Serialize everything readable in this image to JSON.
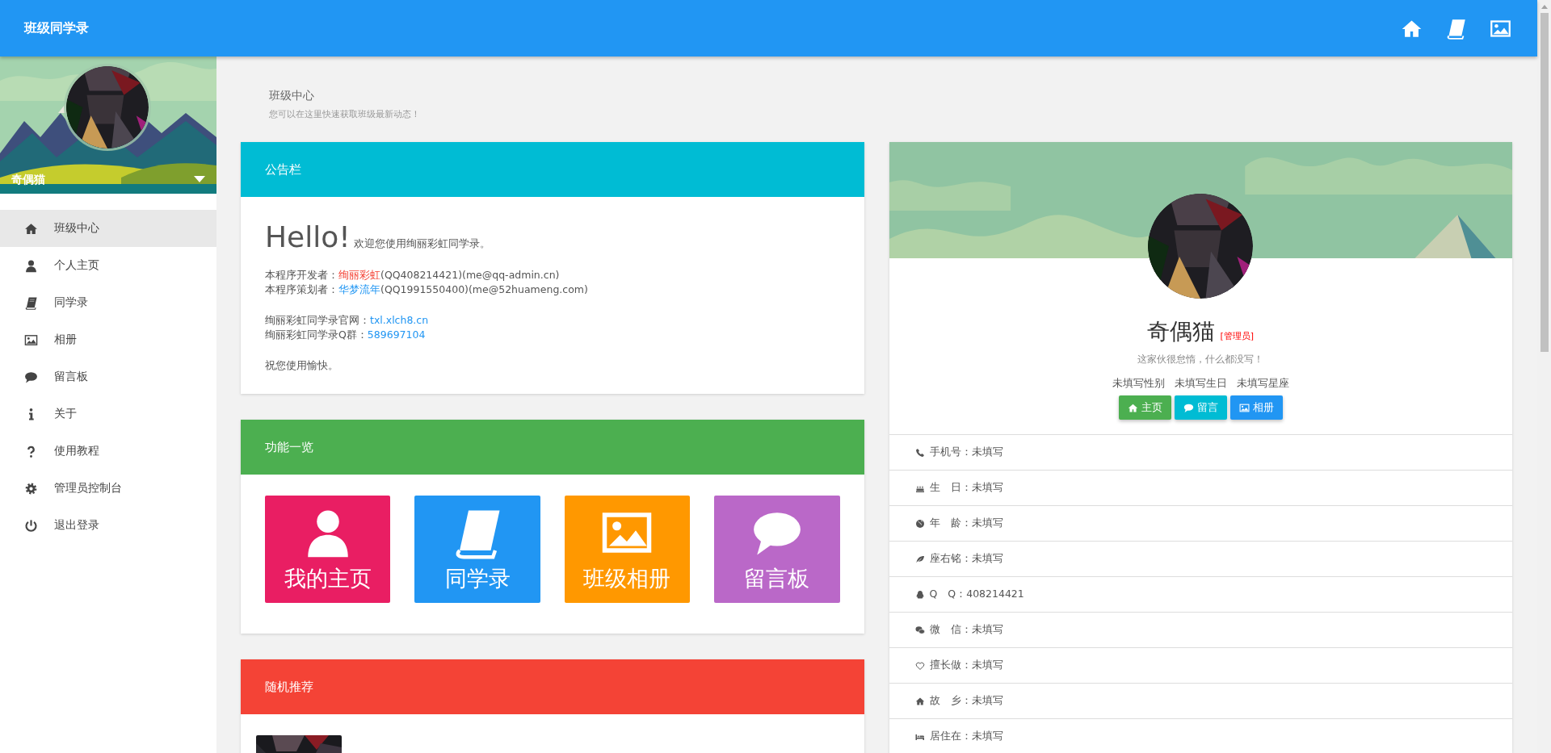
{
  "header": {
    "title": "班级同学录",
    "actions": [
      {
        "kind": "home"
      },
      {
        "kind": "book"
      },
      {
        "kind": "picture"
      }
    ]
  },
  "sidebar": {
    "user_name": "奇偶猫",
    "items": [
      {
        "label": "班级中心",
        "kind": "home",
        "selected": true
      },
      {
        "label": "个人主页",
        "kind": "user",
        "selected": false
      },
      {
        "label": "同学录",
        "kind": "book",
        "selected": false
      },
      {
        "label": "相册",
        "kind": "picture",
        "selected": false
      },
      {
        "label": "留言板",
        "kind": "comment",
        "selected": false
      },
      {
        "label": "关于",
        "kind": "info",
        "selected": false
      },
      {
        "label": "使用教程",
        "kind": "question",
        "selected": false
      },
      {
        "label": "管理员控制台",
        "kind": "gear",
        "selected": false
      },
      {
        "label": "退出登录",
        "kind": "power",
        "selected": false
      }
    ]
  },
  "page": {
    "title": "班级中心",
    "subtitle": "您可以在这里快速获取班级最新动态！"
  },
  "notice": {
    "title": "公告栏",
    "heading": "Hello!",
    "greeting": "欢迎您使用绚丽彩虹同学录。",
    "paragraphs": [
      [
        {
          "label": "本程序开发者：",
          "link": "绚丽彩虹",
          "kind": "highlight",
          "rest": "(QQ408214421)(me@qq-admin.cn)"
        },
        {
          "label": "本程序策划者：",
          "link": "华梦流年",
          "kind": "link",
          "rest": "(QQ1991550400)(me@52huameng.com)"
        }
      ],
      [
        {
          "label": "绚丽彩虹同学录官网：",
          "link": "txl.xlch8.cn",
          "kind": "link"
        },
        {
          "label": "绚丽彩虹同学录Q群：",
          "link": "589697104",
          "kind": "link"
        }
      ],
      [
        {
          "label": "祝您使用愉快。"
        }
      ]
    ]
  },
  "features": {
    "title": "功能一览",
    "tiles": [
      {
        "label": "我的主页",
        "kind": "user",
        "color": "#e91e63"
      },
      {
        "label": "同学录",
        "kind": "book",
        "color": "#2196f3"
      },
      {
        "label": "班级相册",
        "kind": "picture",
        "color": "#ff9800"
      },
      {
        "label": "留言板",
        "kind": "comment",
        "color": "#ba68c8"
      }
    ]
  },
  "random": {
    "title": "随机推荐",
    "items": [
      {
        "kind": "picture"
      }
    ]
  },
  "profile": {
    "name": "奇偶猫",
    "role": "[管理员]",
    "bio": "这家伙很怠惰，什么都没写！",
    "tags": [
      "未填写性别",
      "未填写生日",
      "未填写星座"
    ],
    "buttons": [
      {
        "label": "主页",
        "kind": "home",
        "color": "#4caf50"
      },
      {
        "label": "留言",
        "kind": "comment",
        "color": "#00bcd4"
      },
      {
        "label": "相册",
        "kind": "picture",
        "color": "#2196f3"
      }
    ],
    "fields": [
      {
        "kind": "phone",
        "text": "手机号：未填写"
      },
      {
        "kind": "cake",
        "text": "生　日：未填写"
      },
      {
        "kind": "globe",
        "text": "年　龄：未填写"
      },
      {
        "kind": "leaf",
        "text": "座右铭：未填写"
      },
      {
        "kind": "penguin",
        "text": "Q　Q：408214421"
      },
      {
        "kind": "wechat",
        "text": "微　信：未填写"
      },
      {
        "kind": "heart",
        "text": "擅长做：未填写"
      },
      {
        "kind": "home",
        "text": "故　乡：未填写"
      },
      {
        "kind": "bed",
        "text": "居住在：未填写"
      }
    ]
  }
}
